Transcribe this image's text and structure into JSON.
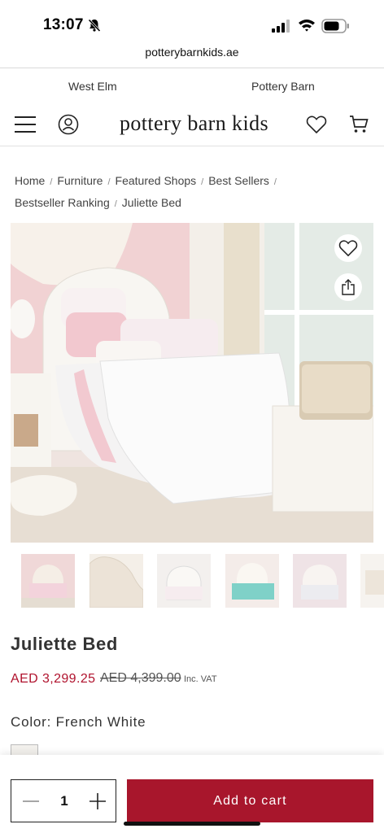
{
  "status": {
    "time": "13:07"
  },
  "browser": {
    "url": "potterybarnkids.ae"
  },
  "brands": [
    "West Elm",
    "Pottery Barn"
  ],
  "header": {
    "logo": "pottery barn kids"
  },
  "breadcrumb": [
    "Home",
    "Furniture",
    "Featured Shops",
    "Best Sellers",
    "Bestseller Ranking",
    "Juliette Bed"
  ],
  "product": {
    "title": "Juliette Bed",
    "sale_price": "AED 3,299.25",
    "original_price": "AED 4,399.00",
    "vat_note": "Inc. VAT",
    "color_label": "Color: French White"
  },
  "cart": {
    "quantity": "1",
    "add_label": "Add to cart"
  },
  "colors": {
    "accent": "#a8162c",
    "sale": "#b0122d"
  },
  "icons": [
    "menu-icon",
    "account-icon",
    "heart-icon",
    "cart-icon",
    "share-icon",
    "minus-icon",
    "plus-icon"
  ]
}
